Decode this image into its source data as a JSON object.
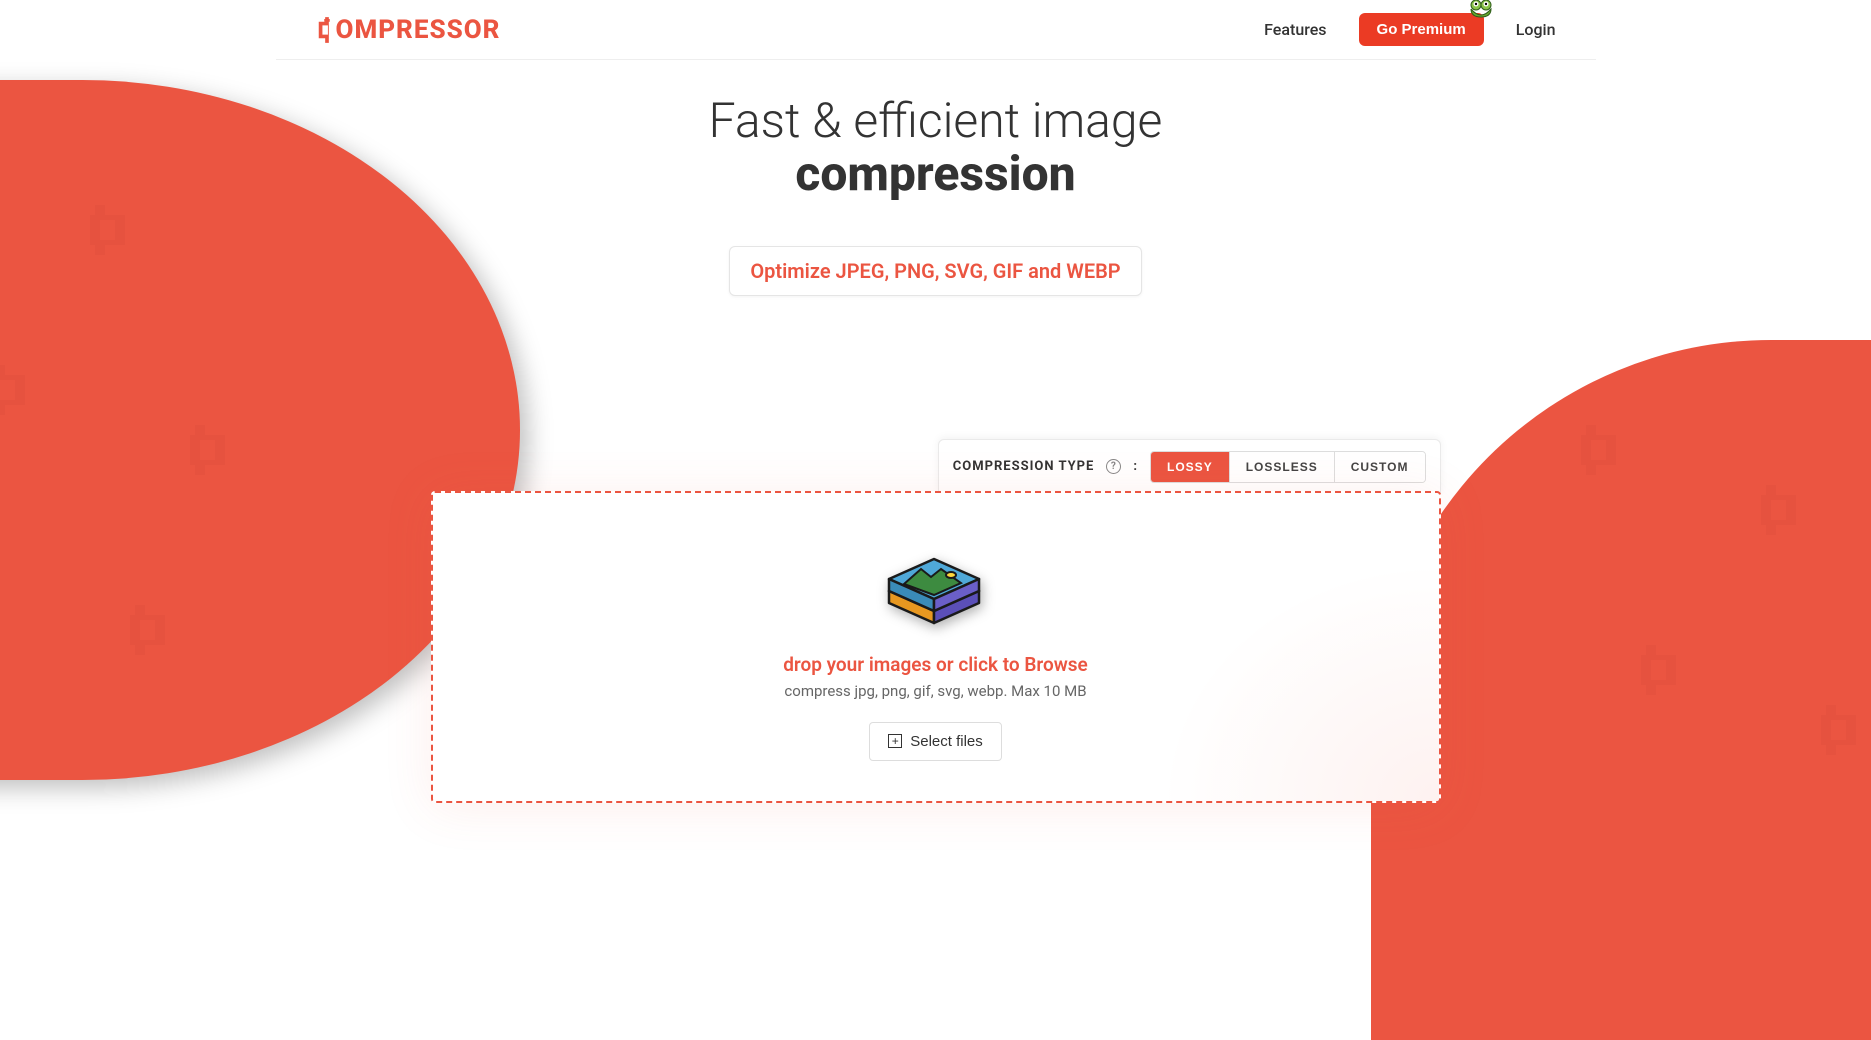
{
  "brand": "OMPRESSOR",
  "nav": {
    "features": "Features",
    "premium": "Go Premium",
    "login": "Login"
  },
  "hero": {
    "title_light": "Fast & efficient image",
    "title_bold": "compression",
    "formats": "Optimize JPEG, PNG, SVG, GIF and WEBP"
  },
  "compression": {
    "label": "COMPRESSION TYPE",
    "colon": ":",
    "help": "?",
    "options": {
      "lossy": "LOSSY",
      "lossless": "LOSSLESS",
      "custom": "CUSTOM"
    }
  },
  "dropzone": {
    "title": "drop your images or click to Browse",
    "subtitle": "compress jpg, png, gif, svg, webp. Max 10 MB",
    "select_button": "Select files"
  }
}
